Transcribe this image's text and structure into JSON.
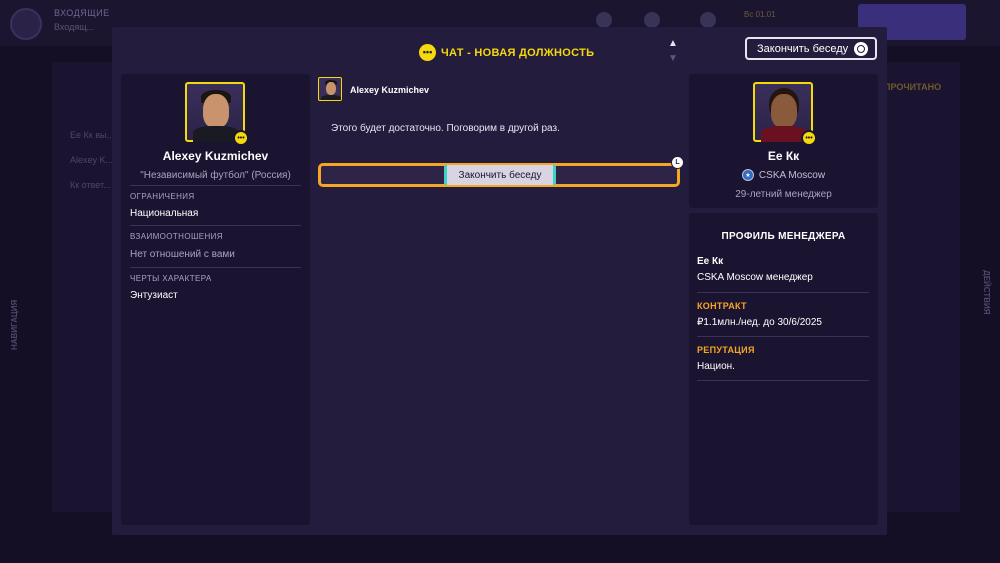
{
  "background": {
    "inbox_title": "ВХОДЯЩИЕ",
    "inbox_sub": "Входящ...",
    "date": "Вс 01.01",
    "unread": "ПРОЧИТАНО",
    "nav_label": "НАВИГАЦИЯ",
    "actions_label": "ДЕЙСТВИЯ",
    "lines": [
      "Ее Кк вы...",
      "Alexey K...",
      "Кк ответ..."
    ]
  },
  "modal": {
    "title": "ЧАТ - НОВАЯ ДОЛЖНОСТЬ",
    "end_button": "Закончить беседу"
  },
  "left_person": {
    "name": "Alexey Kuzmichev",
    "affiliation": "\"Независимый футбол\" (Россия)",
    "sections": [
      {
        "label": "ОГРАНИЧЕНИЯ",
        "value": "Национальная"
      },
      {
        "label": "ВЗАИМООТНОШЕНИЯ",
        "value": "Нет отношений с вами"
      },
      {
        "label": "ЧЕРТЫ ХАРАКТЕРА",
        "value": "Энтузиаст"
      }
    ]
  },
  "chat": {
    "speaker": "Alexey Kuzmichev",
    "message": "Этого будет достаточно. Поговорим в другой раз.",
    "option": "Закончить беседу",
    "option_key": "L"
  },
  "right_person": {
    "name": "Ее Кк",
    "club": "CSKA Moscow",
    "age_role": "29-летний менеджер"
  },
  "profile": {
    "title": "ПРОФИЛЬ МЕНЕДЖЕРА",
    "name": "Ее Кк",
    "role": "CSKA Moscow менеджер",
    "contract_label": "КОНТРАКТ",
    "contract_value": "₽1.1млн./нед. до 30/6/2025",
    "reputation_label": "РЕПУТАЦИЯ",
    "reputation_value": "Национ."
  },
  "colors": {
    "accent_yellow": "#f5d90a",
    "accent_orange": "#f5a623",
    "teal": "#3fd2c7",
    "panel": "#1b1430",
    "modal": "#241c3c"
  },
  "icons": [
    "chat-bubble-icon",
    "chevron-up-icon",
    "chevron-down-icon",
    "end-circle-icon",
    "club-crest-icon"
  ]
}
